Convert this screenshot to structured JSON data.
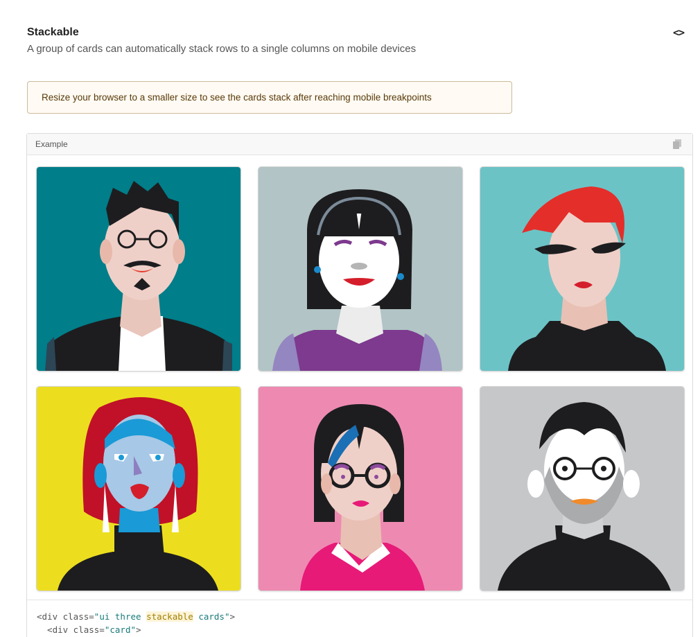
{
  "section": {
    "title": "Stackable",
    "description": "A group of cards can automatically stack rows to a single columns on mobile devices",
    "code_toggle_icon": "code-brackets-icon",
    "code_toggle_label": "<>"
  },
  "notice": {
    "text": "Resize your browser to a smaller size to see the cards stack after reaching mobile breakpoints",
    "background": "#fffaf3",
    "border": "#c9ba9b",
    "text_color": "#573a08"
  },
  "example": {
    "label": "Example",
    "copy_icon": "copy-icon",
    "cards": [
      {
        "name": "man with round glasses and mustache",
        "background": "#007e8a"
      },
      {
        "name": "woman with headband and black bob",
        "background": "#b2c4c5"
      },
      {
        "name": "woman with red hair and sunglasses",
        "background": "#6cc3c6"
      },
      {
        "name": "woman with blue face and red hood",
        "background": "#ecde1f"
      },
      {
        "name": "woman with black hair and round glasses",
        "background": "#ee8ab2"
      },
      {
        "name": "man with gray beard and round glasses",
        "background": "#c6c7c9"
      }
    ],
    "code": {
      "line1": {
        "open": "<div class=",
        "q1": "\"ui three ",
        "hl": "stackable",
        "q2": " cards\"",
        "close": ">"
      },
      "line2": {
        "open": "  <div class=",
        "str": "\"card\"",
        "close": ">"
      }
    }
  }
}
